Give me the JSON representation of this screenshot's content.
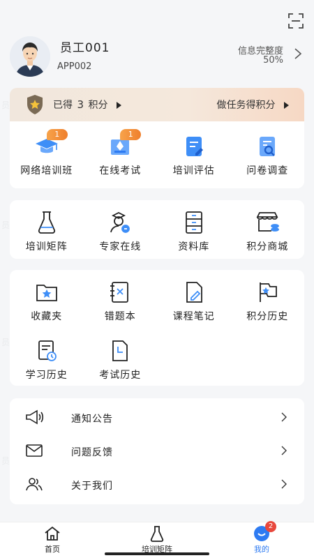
{
  "header": {
    "scan_icon": "scan-icon"
  },
  "profile": {
    "name": "员工001",
    "id": "APP002",
    "info_label": "信息完整度",
    "info_value": "50%"
  },
  "points": {
    "earned_prefix": "已得",
    "earned_value": "3",
    "earned_suffix": "积分",
    "task_label": "做任务得积分"
  },
  "section1": [
    {
      "label": "网络培训班",
      "badge": "1",
      "icon": "graduation-cap-icon"
    },
    {
      "label": "在线考试",
      "badge": "1",
      "icon": "pen-tablet-icon"
    },
    {
      "label": "培训评估",
      "icon": "document-edit-icon"
    },
    {
      "label": "问卷调查",
      "icon": "document-search-icon"
    }
  ],
  "section2": [
    {
      "label": "培训矩阵",
      "icon": "flask-icon"
    },
    {
      "label": "专家在线",
      "icon": "expert-icon"
    },
    {
      "label": "资料库",
      "icon": "cabinet-icon"
    },
    {
      "label": "积分商城",
      "icon": "shop-icon"
    }
  ],
  "section3": [
    {
      "label": "收藏夹",
      "icon": "star-folder-icon"
    },
    {
      "label": "错题本",
      "icon": "wrong-book-icon"
    },
    {
      "label": "课程笔记",
      "icon": "note-icon"
    },
    {
      "label": "积分历史",
      "icon": "flag-icon"
    },
    {
      "label": "学习历史",
      "icon": "study-history-icon"
    },
    {
      "label": "考试历史",
      "icon": "exam-history-icon"
    }
  ],
  "list": [
    {
      "label": "通知公告",
      "icon": "megaphone-icon"
    },
    {
      "label": "问题反馈",
      "icon": "mail-icon"
    },
    {
      "label": "关于我们",
      "icon": "people-icon"
    }
  ],
  "tabbar": {
    "tabs": [
      {
        "label": "首页",
        "icon": "home-icon"
      },
      {
        "label": "培训矩阵",
        "icon": "flask-icon"
      },
      {
        "label": "我的",
        "icon": "profile-icon",
        "badge": "2"
      }
    ]
  },
  "watermark": "员工001(APP002)",
  "colors": {
    "accent": "#2e7bf2",
    "badge_orange": "#f28a33",
    "badge_red": "#e8483d"
  }
}
